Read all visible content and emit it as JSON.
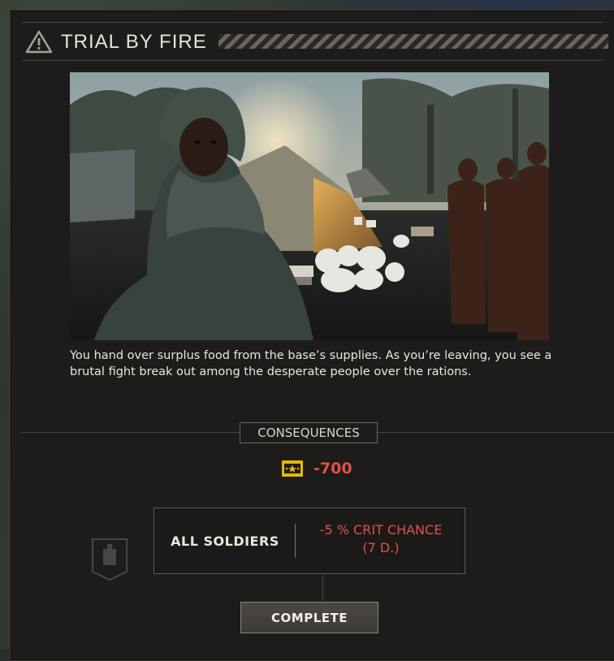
{
  "dialog": {
    "title": "TRIAL BY FIRE",
    "warning_icon": "warning-triangle-icon",
    "image_alt": "event-illustration",
    "story": "You hand over surplus food from the base’s supplies. As you’re leaving, you see a brutal fight break out among the desperate people over the rations."
  },
  "consequences": {
    "heading": "CONSEQUENCES",
    "resource": {
      "icon": "intel-currency-icon",
      "value": "-700"
    },
    "effect": {
      "target": "ALL SOLDIERS",
      "line1": "-5 % CRIT CHANCE",
      "line2": "(7 D.)"
    }
  },
  "actions": {
    "complete_label": "COMPLETE"
  },
  "colors": {
    "negative": "#e0514a",
    "currency_gold": "#e8b50c",
    "panel": "#1d1c1a"
  }
}
